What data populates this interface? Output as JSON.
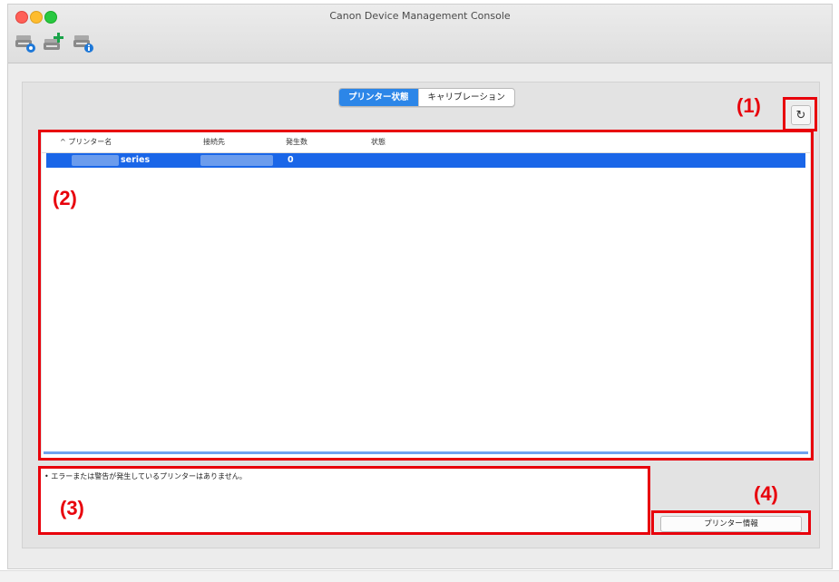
{
  "window": {
    "title": "Canon Device Management Console"
  },
  "toolbar": {
    "icons": [
      "printer-settings-icon",
      "add-printer-icon",
      "printer-info-icon"
    ]
  },
  "tabs": [
    {
      "label": "プリンター状態",
      "active": true
    },
    {
      "label": "キャリブレーション",
      "active": false
    }
  ],
  "table": {
    "columns": [
      "^ プリンター名",
      "接続先",
      "発生数",
      "状態"
    ],
    "rows": [
      {
        "name": "series",
        "count": "0",
        "selected": true
      }
    ]
  },
  "message": "• エラーまたは警告が発生しているプリンターはありません。",
  "printer_info_button": "プリンター情報",
  "annotations": {
    "a1": "(1)",
    "a2": "(2)",
    "a3": "(3)",
    "a4": "(4)"
  },
  "colors": {
    "annotation_red": "#e8000b",
    "selection_blue": "#1a66e8",
    "active_tab_blue": "#2c86e8"
  }
}
